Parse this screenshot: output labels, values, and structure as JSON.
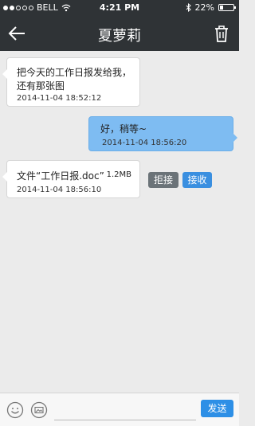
{
  "status_bar": {
    "carrier": "BELL",
    "time": "4:21 PM",
    "battery_text": "22%",
    "battery_level": 0.22,
    "signal_dots_filled": 2,
    "signal_dots_total": 5
  },
  "header": {
    "title": "夏萝莉"
  },
  "messages": [
    {
      "side": "left",
      "text": "把今天的工作日报发给我，还有那张图",
      "time": "2014-11-04 18:52:12"
    },
    {
      "side": "right",
      "text": "好，稍等~",
      "time": "2014-11-04 18:56:20"
    },
    {
      "side": "left",
      "file_name": "文件“工作日报.doc”",
      "file_size": "1.2MB",
      "time": "2014-11-04 18:56:10",
      "reject_label": "拒接",
      "accept_label": "接收"
    }
  ],
  "input_bar": {
    "placeholder": "",
    "send_label": "发送"
  },
  "colors": {
    "bar_bg": "#2f3336",
    "bubble_right": "#7ebcf2",
    "accent": "#2d8fe6",
    "reject": "#6b7378"
  }
}
